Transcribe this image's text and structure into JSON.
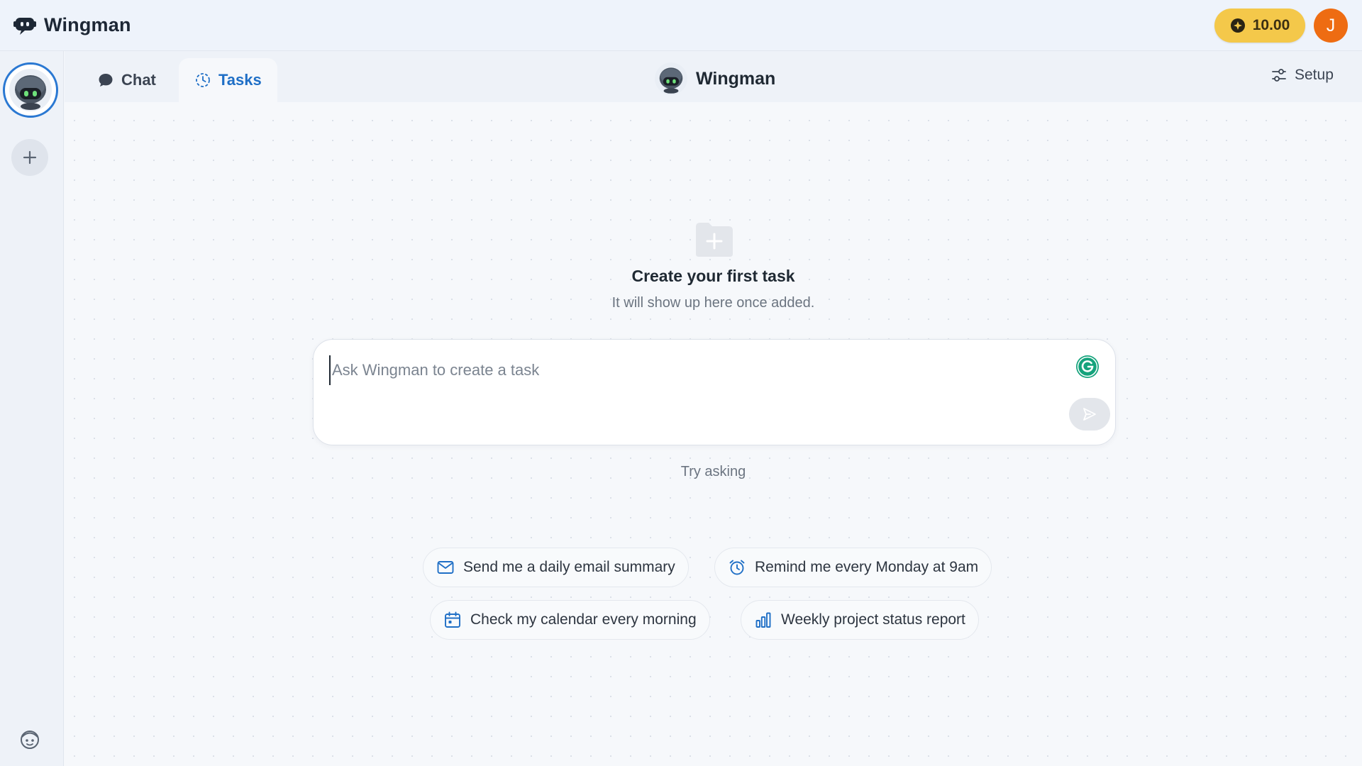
{
  "app": {
    "title": "Wingman",
    "credits": "10.00",
    "user_initial": "J"
  },
  "colors": {
    "accent": "#1f6fc6",
    "credits_bg": "#f4c84a",
    "user_avatar_bg": "#ee6c12",
    "grammarly": "#15a37c"
  },
  "tabs": [
    {
      "label": "Chat",
      "icon": "chat-bubble-icon",
      "active": false
    },
    {
      "label": "Tasks",
      "icon": "tasks-icon",
      "active": true
    }
  ],
  "header": {
    "agent_name": "Wingman",
    "setup_label": "Setup"
  },
  "empty_state": {
    "title": "Create your first task",
    "subtitle": "It will show up here once added."
  },
  "composer": {
    "placeholder": "Ask Wingman to create a task",
    "value": ""
  },
  "suggestions": {
    "heading": "Try asking",
    "items": [
      {
        "label": "Send me a daily email summary",
        "icon": "mail-icon"
      },
      {
        "label": "Remind me every Monday at 9am",
        "icon": "alarm-clock-icon"
      },
      {
        "label": "Check my calendar every morning",
        "icon": "calendar-icon"
      },
      {
        "label": "Weekly project status report",
        "icon": "bar-chart-icon"
      }
    ]
  }
}
